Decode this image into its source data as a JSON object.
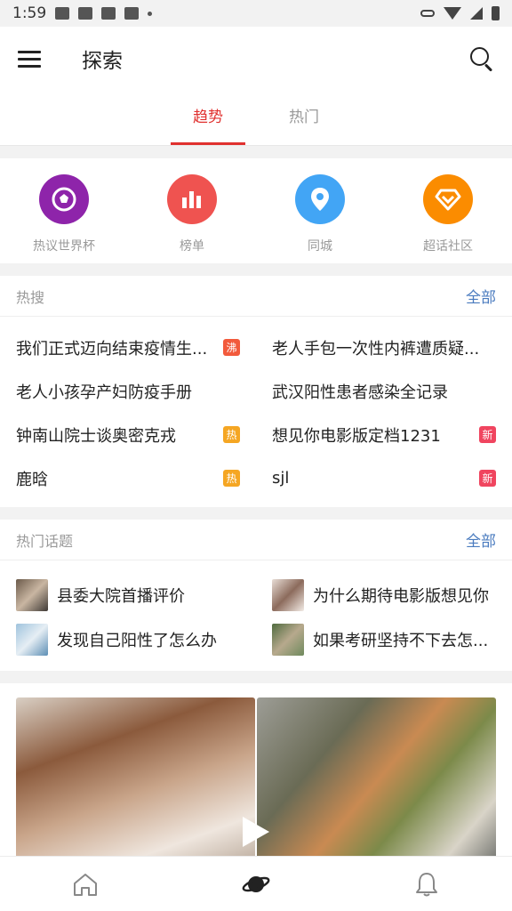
{
  "status_bar": {
    "time": "1:59"
  },
  "header": {
    "title": "探索"
  },
  "tabs": [
    {
      "label": "趋势",
      "active": true
    },
    {
      "label": "热门",
      "active": false
    }
  ],
  "categories": [
    {
      "label": "热议世界杯",
      "icon": "soccer-ball-icon",
      "color": "#8e24aa"
    },
    {
      "label": "榜单",
      "icon": "bar-chart-icon",
      "color": "#ef5350"
    },
    {
      "label": "同城",
      "icon": "location-pin-icon",
      "color": "#42a5f5"
    },
    {
      "label": "超话社区",
      "icon": "diamond-icon",
      "color": "#fb8c00"
    }
  ],
  "hot_search": {
    "title": "热搜",
    "all_label": "全部",
    "items": [
      {
        "text": "我们正式迈向结束疫情生...",
        "badge": "沸",
        "badge_type": "boil"
      },
      {
        "text": "老人手包一次性内裤遭质疑...",
        "badge": "",
        "badge_type": ""
      },
      {
        "text": "老人小孩孕产妇防疫手册",
        "badge": "",
        "badge_type": ""
      },
      {
        "text": "武汉阳性患者感染全记录",
        "badge": "",
        "badge_type": ""
      },
      {
        "text": "钟南山院士谈奥密克戎",
        "badge": "热",
        "badge_type": "hot"
      },
      {
        "text": "想见你电影版定档1231",
        "badge": "新",
        "badge_type": "new"
      },
      {
        "text": "鹿晗",
        "badge": "热",
        "badge_type": "hot"
      },
      {
        "text": "sjl",
        "badge": "新",
        "badge_type": "new"
      }
    ]
  },
  "hot_topics": {
    "title": "热门话题",
    "all_label": "全部",
    "items": [
      {
        "text": "县委大院首播评价"
      },
      {
        "text": "为什么期待电影版想见你"
      },
      {
        "text": "发现自己阳性了怎么办"
      },
      {
        "text": "如果考研坚持不下去怎..."
      }
    ]
  },
  "bottom_nav": [
    {
      "icon": "home-icon",
      "active": false
    },
    {
      "icon": "planet-icon",
      "active": true
    },
    {
      "icon": "bell-icon",
      "active": false
    }
  ]
}
